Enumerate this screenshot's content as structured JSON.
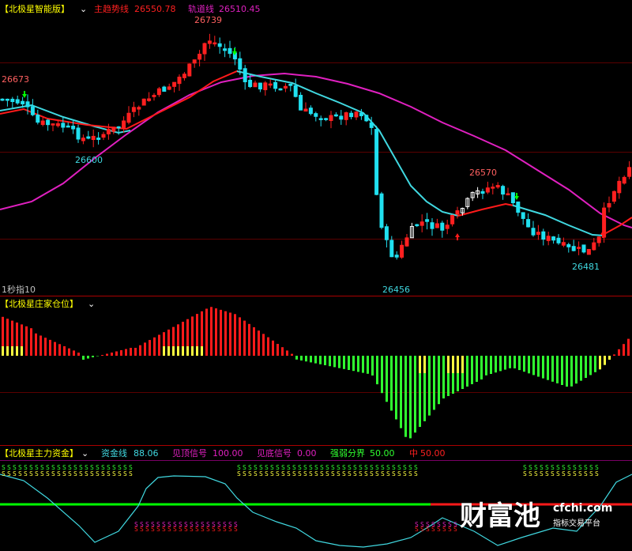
{
  "colors": {
    "bg": "#000000",
    "frame": "#aa0000",
    "up": "#ff2020",
    "down": "#20e0f0",
    "white": "#ffffff",
    "magenta": "#e020c0",
    "cyan": "#40d8e0",
    "yellow": "#ffff40",
    "green": "#30ff30",
    "lime": "#00ff00",
    "red": "#ff1a1a",
    "goldtext": "#ffff00"
  },
  "panel1": {
    "indicator_title": "【北极星智能版】",
    "trend_label": "主趋势线",
    "trend_value": "26550.78",
    "track_label": "轨道线",
    "track_value": "26510.45",
    "peak_label": "26739",
    "left_label": "26673",
    "low1_label": "26600",
    "high2_label": "26570",
    "low2_label": "26456",
    "low3_label": "26481",
    "bottom_label": "1秒指10"
  },
  "panel2": {
    "indicator_title": "【北极星庄家仓位】"
  },
  "panel3": {
    "indicator_title": "【北极星主力资金】",
    "fund_label": "资金线",
    "fund_value": "88.06",
    "top_signal_label": "见顶信号",
    "top_signal_value": "100.00",
    "bottom_signal_label": "见底信号",
    "bottom_signal_value": "0.00",
    "strength_label": "强弱分界",
    "strength_value": "50.00",
    "mid_label": "中",
    "mid_value": "50.00",
    "s_marker": "S"
  },
  "watermark": {
    "brand": "财富池",
    "site": "cfchi.com",
    "slogan": "指标交易平台"
  }
}
